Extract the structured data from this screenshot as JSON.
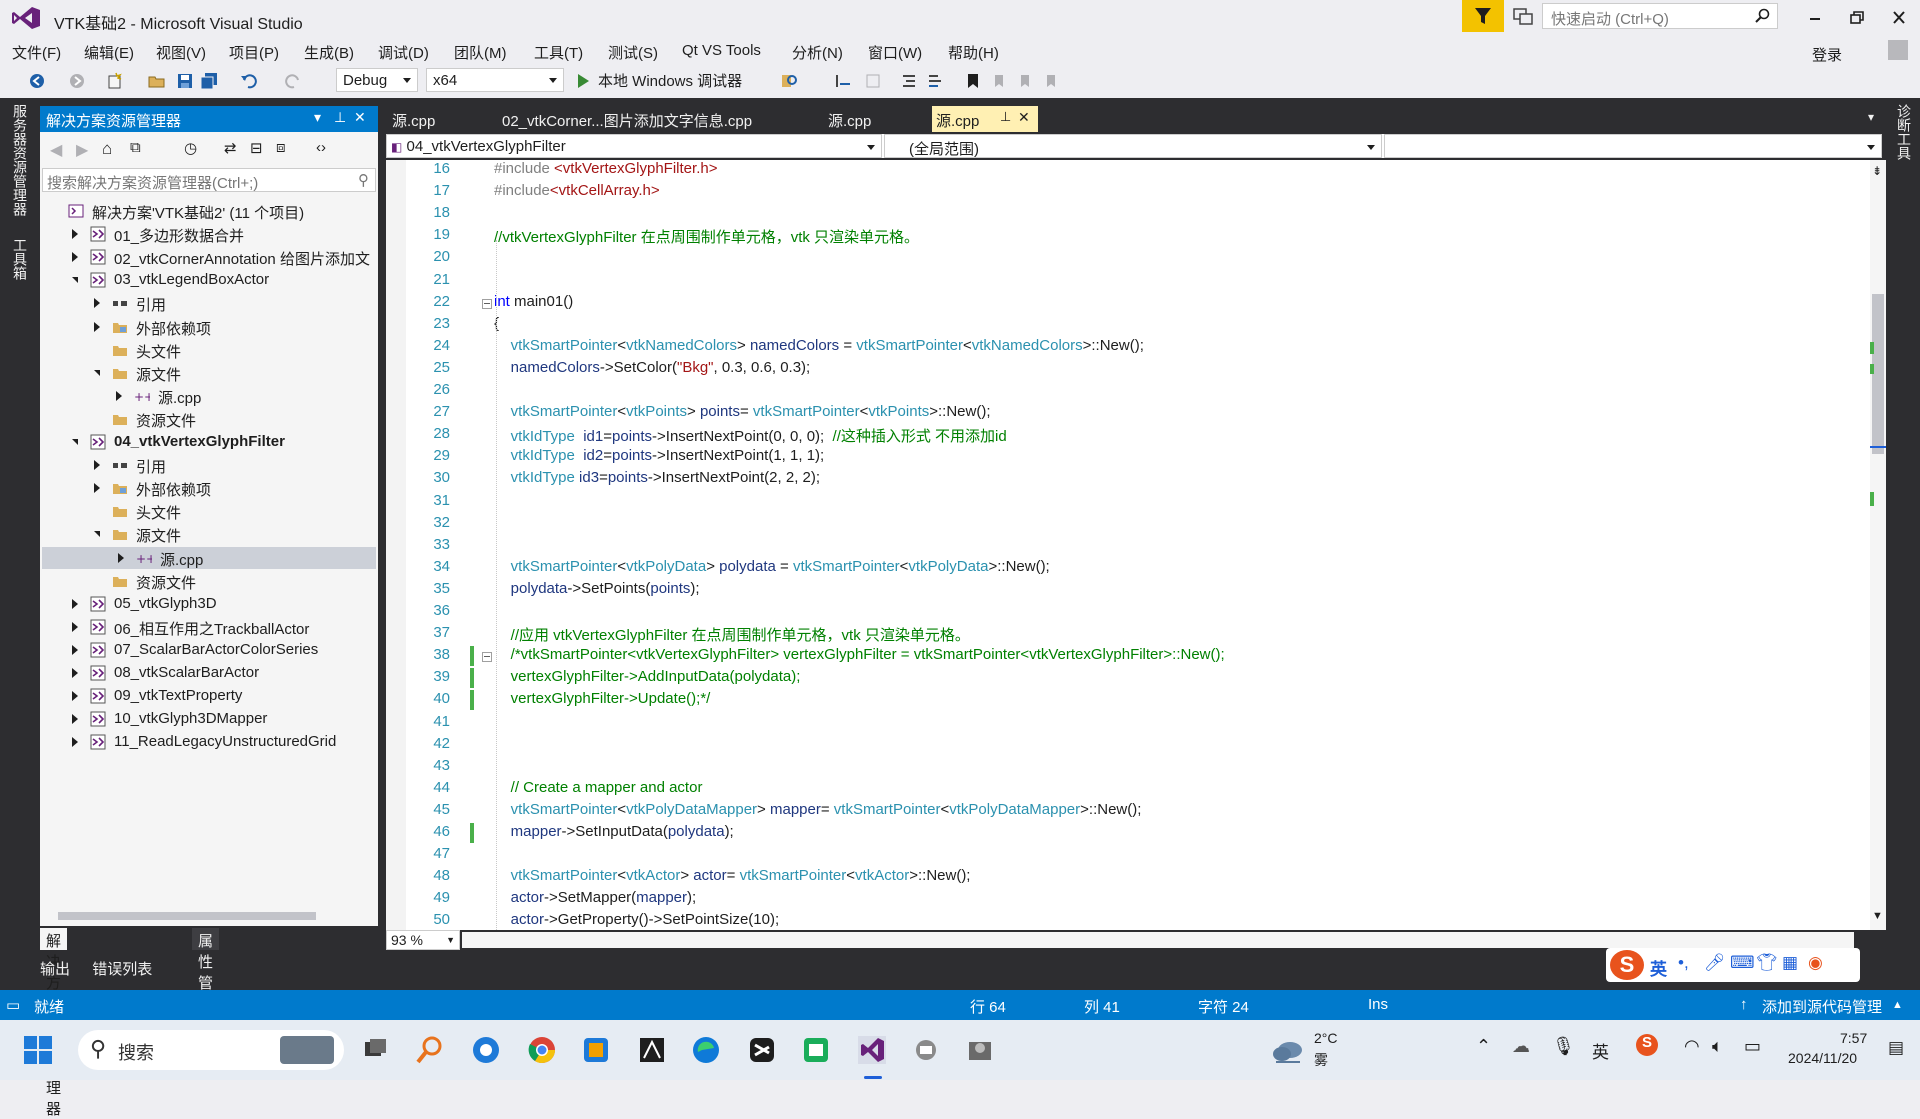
{
  "window": {
    "title": "VTK基础2 - Microsoft Visual Studio",
    "quick_launch_placeholder": "快速启动 (Ctrl+Q)",
    "login": "登录"
  },
  "menu": [
    "文件(F)",
    "编辑(E)",
    "视图(V)",
    "项目(P)",
    "生成(B)",
    "调试(D)",
    "团队(M)",
    "工具(T)",
    "测试(S)",
    "Qt VS Tools",
    "分析(N)",
    "窗口(W)",
    "帮助(H)"
  ],
  "toolbar": {
    "config": "Debug",
    "platform": "x64",
    "debugger": "本地 Windows 调试器"
  },
  "left_rail": {
    "server_explorer": "服务器资源管理器",
    "toolbox": "工具箱"
  },
  "right_rail": {
    "diagnostics": "诊断工具"
  },
  "solution_explorer": {
    "title": "解决方案资源管理器",
    "search_placeholder": "搜索解决方案资源管理器(Ctrl+;)",
    "tree": [
      {
        "label": "解决方案'VTK基础2' (11 个项目)",
        "depth": 0,
        "twisty": "none",
        "icon": "solution-icon"
      },
      {
        "label": "01_多边形数据合并",
        "depth": 1,
        "twisty": "closed",
        "icon": "project-icon"
      },
      {
        "label": "02_vtkCornerAnnotation 给图片添加文",
        "depth": 1,
        "twisty": "closed",
        "icon": "project-icon"
      },
      {
        "label": "03_vtkLegendBoxActor",
        "depth": 1,
        "twisty": "open",
        "icon": "project-icon"
      },
      {
        "label": "引用",
        "depth": 2,
        "twisty": "closed",
        "icon": "reference-icon"
      },
      {
        "label": "外部依赖项",
        "depth": 2,
        "twisty": "closed",
        "icon": "external-deps-icon"
      },
      {
        "label": "头文件",
        "depth": 2,
        "twisty": "none",
        "icon": "folder-icon"
      },
      {
        "label": "源文件",
        "depth": 2,
        "twisty": "open",
        "icon": "folder-icon"
      },
      {
        "label": "源.cpp",
        "depth": 3,
        "twisty": "closed",
        "icon": "cpp-file-icon"
      },
      {
        "label": "资源文件",
        "depth": 2,
        "twisty": "none",
        "icon": "folder-icon"
      },
      {
        "label": "04_vtkVertexGlyphFilter",
        "depth": 1,
        "twisty": "open",
        "icon": "project-icon",
        "bold": true
      },
      {
        "label": "引用",
        "depth": 2,
        "twisty": "closed",
        "icon": "reference-icon"
      },
      {
        "label": "外部依赖项",
        "depth": 2,
        "twisty": "closed",
        "icon": "external-deps-icon"
      },
      {
        "label": "头文件",
        "depth": 2,
        "twisty": "none",
        "icon": "folder-icon"
      },
      {
        "label": "源文件",
        "depth": 2,
        "twisty": "open",
        "icon": "folder-icon"
      },
      {
        "label": "源.cpp",
        "depth": 3,
        "twisty": "closed",
        "icon": "cpp-file-icon",
        "selected": true
      },
      {
        "label": "资源文件",
        "depth": 2,
        "twisty": "none",
        "icon": "folder-icon"
      },
      {
        "label": "05_vtkGlyph3D",
        "depth": 1,
        "twisty": "closed",
        "icon": "project-icon"
      },
      {
        "label": "06_相互作用之TrackballActor",
        "depth": 1,
        "twisty": "closed",
        "icon": "project-icon"
      },
      {
        "label": "07_ScalarBarActorColorSeries",
        "depth": 1,
        "twisty": "closed",
        "icon": "project-icon"
      },
      {
        "label": "08_vtkScalarBarActor",
        "depth": 1,
        "twisty": "closed",
        "icon": "project-icon"
      },
      {
        "label": "09_vtkTextProperty",
        "depth": 1,
        "twisty": "closed",
        "icon": "project-icon"
      },
      {
        "label": "10_vtkGlyph3DMapper",
        "depth": 1,
        "twisty": "closed",
        "icon": "project-icon"
      },
      {
        "label": "11_ReadLegacyUnstructuredGrid",
        "depth": 1,
        "twisty": "closed",
        "icon": "project-icon"
      }
    ],
    "bottom_tabs": [
      "解决方案资源管理器",
      "属性管理器"
    ]
  },
  "output_tabs": [
    "输出",
    "错误列表"
  ],
  "editor": {
    "tabs": [
      {
        "label": "源.cpp",
        "active": false
      },
      {
        "label": "02_vtkCorner...图片添加文字信息.cpp",
        "active": false
      },
      {
        "label": "源.cpp",
        "active": false
      },
      {
        "label": "源.cpp",
        "active": true
      }
    ],
    "project_dropdown": "04_vtkVertexGlyphFilter",
    "scope_dropdown": "(全局范围)",
    "zoom": "93 %",
    "lines": [
      {
        "n": "16",
        "t": [
          [
            "inc",
            "#include "
          ],
          [
            "lib",
            "<vtkVertexGlyphFilter.h>"
          ]
        ]
      },
      {
        "n": "17",
        "t": [
          [
            "inc",
            "#include"
          ],
          [
            "lib",
            "<vtkCellArray.h>"
          ]
        ]
      },
      {
        "n": "18",
        "t": []
      },
      {
        "n": "19",
        "t": [
          [
            "cm",
            "//vtkVertexGlyphFilter 在点周围制作单元格，vtk 只渲染单元格。"
          ]
        ]
      },
      {
        "n": "20",
        "t": []
      },
      {
        "n": "21",
        "t": []
      },
      {
        "n": "22",
        "t": [
          [
            "kw",
            "int"
          ],
          [
            "cd",
            " main01()"
          ]
        ],
        "fold": true
      },
      {
        "n": "23",
        "t": [
          [
            "cd",
            "{"
          ]
        ]
      },
      {
        "n": "24",
        "t": [
          [
            "cd",
            "    "
          ],
          [
            "ty",
            "vtkSmartPointer"
          ],
          [
            "cd",
            "<"
          ],
          [
            "ty",
            "vtkNamedColors"
          ],
          [
            "cd",
            "> "
          ],
          [
            "vr",
            "namedColors"
          ],
          [
            "cd",
            " = "
          ],
          [
            "ty",
            "vtkSmartPointer"
          ],
          [
            "cd",
            "<"
          ],
          [
            "ty",
            "vtkNamedColors"
          ],
          [
            "cd",
            ">::New();"
          ]
        ]
      },
      {
        "n": "25",
        "t": [
          [
            "cd",
            "    "
          ],
          [
            "vr",
            "namedColors"
          ],
          [
            "cd",
            "->SetColor("
          ],
          [
            "st",
            "\"Bkg\""
          ],
          [
            "cd",
            ", 0.3, 0.6, 0.3);"
          ]
        ]
      },
      {
        "n": "26",
        "t": []
      },
      {
        "n": "27",
        "t": [
          [
            "cd",
            "    "
          ],
          [
            "ty",
            "vtkSmartPointer"
          ],
          [
            "cd",
            "<"
          ],
          [
            "ty",
            "vtkPoints"
          ],
          [
            "cd",
            "> "
          ],
          [
            "vr",
            "points"
          ],
          [
            "cd",
            "= "
          ],
          [
            "ty",
            "vtkSmartPointer"
          ],
          [
            "cd",
            "<"
          ],
          [
            "ty",
            "vtkPoints"
          ],
          [
            "cd",
            ">::New();"
          ]
        ]
      },
      {
        "n": "28",
        "t": [
          [
            "cd",
            "    "
          ],
          [
            "ty",
            "vtkIdType"
          ],
          [
            "cd",
            "  "
          ],
          [
            "vr",
            "id1"
          ],
          [
            "cd",
            "="
          ],
          [
            "vr",
            "points"
          ],
          [
            "cd",
            "->InsertNextPoint(0, 0, 0);  "
          ],
          [
            "cm",
            "//这种插入形式 不用添加id"
          ]
        ]
      },
      {
        "n": "29",
        "t": [
          [
            "cd",
            "    "
          ],
          [
            "ty",
            "vtkIdType"
          ],
          [
            "cd",
            "  "
          ],
          [
            "vr",
            "id2"
          ],
          [
            "cd",
            "="
          ],
          [
            "vr",
            "points"
          ],
          [
            "cd",
            "->InsertNextPoint(1, 1, 1);"
          ]
        ]
      },
      {
        "n": "30",
        "t": [
          [
            "cd",
            "    "
          ],
          [
            "ty",
            "vtkIdType"
          ],
          [
            "cd",
            " "
          ],
          [
            "vr",
            "id3"
          ],
          [
            "cd",
            "="
          ],
          [
            "vr",
            "points"
          ],
          [
            "cd",
            "->InsertNextPoint(2, 2, 2);"
          ]
        ]
      },
      {
        "n": "31",
        "t": []
      },
      {
        "n": "32",
        "t": []
      },
      {
        "n": "33",
        "t": []
      },
      {
        "n": "34",
        "t": [
          [
            "cd",
            "    "
          ],
          [
            "ty",
            "vtkSmartPointer"
          ],
          [
            "cd",
            "<"
          ],
          [
            "ty",
            "vtkPolyData"
          ],
          [
            "cd",
            "> "
          ],
          [
            "vr",
            "polydata"
          ],
          [
            "cd",
            " = "
          ],
          [
            "ty",
            "vtkSmartPointer"
          ],
          [
            "cd",
            "<"
          ],
          [
            "ty",
            "vtkPolyData"
          ],
          [
            "cd",
            ">::New();"
          ]
        ]
      },
      {
        "n": "35",
        "t": [
          [
            "cd",
            "    "
          ],
          [
            "vr",
            "polydata"
          ],
          [
            "cd",
            "->SetPoints("
          ],
          [
            "vr",
            "points"
          ],
          [
            "cd",
            ");"
          ]
        ]
      },
      {
        "n": "36",
        "t": []
      },
      {
        "n": "37",
        "t": [
          [
            "cd",
            "    "
          ],
          [
            "cm",
            "//应用 vtkVertexGlyphFilter 在点周围制作单元格，vtk 只渲染单元格。"
          ]
        ]
      },
      {
        "n": "38",
        "t": [
          [
            "cd",
            "    "
          ],
          [
            "cm",
            "/*vtkSmartPointer<vtkVertexGlyphFilter> vertexGlyphFilter = vtkSmartPointer<vtkVertexGlyphFilter>::New();"
          ]
        ],
        "fold": true,
        "chg": true
      },
      {
        "n": "39",
        "t": [
          [
            "cd",
            "    "
          ],
          [
            "cm",
            "vertexGlyphFilter->AddInputData(polydata);"
          ]
        ],
        "chg": true
      },
      {
        "n": "40",
        "t": [
          [
            "cd",
            "    "
          ],
          [
            "cm",
            "vertexGlyphFilter->Update();*/"
          ]
        ],
        "chg": true
      },
      {
        "n": "41",
        "t": []
      },
      {
        "n": "42",
        "t": []
      },
      {
        "n": "43",
        "t": []
      },
      {
        "n": "44",
        "t": [
          [
            "cd",
            "    "
          ],
          [
            "cm",
            "// Create a mapper and actor"
          ]
        ]
      },
      {
        "n": "45",
        "t": [
          [
            "cd",
            "    "
          ],
          [
            "ty",
            "vtkSmartPointer"
          ],
          [
            "cd",
            "<"
          ],
          [
            "ty",
            "vtkPolyDataMapper"
          ],
          [
            "cd",
            "> "
          ],
          [
            "vr",
            "mapper"
          ],
          [
            "cd",
            "= "
          ],
          [
            "ty",
            "vtkSmartPointer"
          ],
          [
            "cd",
            "<"
          ],
          [
            "ty",
            "vtkPolyDataMapper"
          ],
          [
            "cd",
            ">::New();"
          ]
        ]
      },
      {
        "n": "46",
        "t": [
          [
            "cd",
            "    "
          ],
          [
            "vr",
            "mapper"
          ],
          [
            "cd",
            "->SetInputData("
          ],
          [
            "vr",
            "polydata"
          ],
          [
            "cd",
            ");"
          ]
        ],
        "chg": true
      },
      {
        "n": "47",
        "t": []
      },
      {
        "n": "48",
        "t": [
          [
            "cd",
            "    "
          ],
          [
            "ty",
            "vtkSmartPointer"
          ],
          [
            "cd",
            "<"
          ],
          [
            "ty",
            "vtkActor"
          ],
          [
            "cd",
            "> "
          ],
          [
            "vr",
            "actor"
          ],
          [
            "cd",
            "= "
          ],
          [
            "ty",
            "vtkSmartPointer"
          ],
          [
            "cd",
            "<"
          ],
          [
            "ty",
            "vtkActor"
          ],
          [
            "cd",
            ">::New();"
          ]
        ]
      },
      {
        "n": "49",
        "t": [
          [
            "cd",
            "    "
          ],
          [
            "vr",
            "actor"
          ],
          [
            "cd",
            "->SetMapper("
          ],
          [
            "vr",
            "mapper"
          ],
          [
            "cd",
            ");"
          ]
        ]
      },
      {
        "n": "50",
        "t": [
          [
            "cd",
            "    "
          ],
          [
            "vr",
            "actor"
          ],
          [
            "cd",
            "->GetProperty()->SetPointSize(10);"
          ]
        ]
      }
    ]
  },
  "status": {
    "ready": "就绪",
    "line": "行 64",
    "col": "列 41",
    "char": "字符 24",
    "mode": "Ins",
    "source_control": "添加到源代码管理"
  },
  "ime": {
    "lang": "英"
  },
  "taskbar": {
    "search": "搜索",
    "weather_temp": "2°C",
    "weather_desc": "雾",
    "ime_lang": "英",
    "time": "7:57",
    "date": "2024/11/20"
  },
  "colors": {
    "accent": "#007acc",
    "filter_yellow": "#f3c200",
    "active_tab": "#fff0b3",
    "change_bar": "#4ab04a"
  }
}
